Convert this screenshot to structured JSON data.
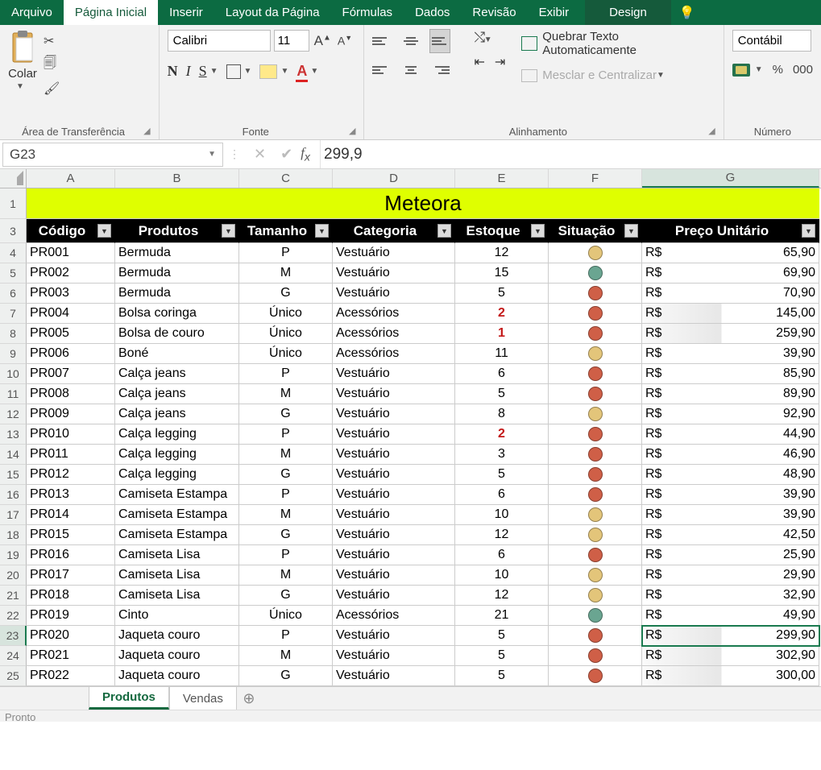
{
  "ribbon_tabs": {
    "arquivo": "Arquivo",
    "inicial": "Página Inicial",
    "inserir": "Inserir",
    "layout": "Layout da Página",
    "formulas": "Fórmulas",
    "dados": "Dados",
    "revisao": "Revisão",
    "exibir": "Exibir",
    "design": "Design"
  },
  "ribbon": {
    "colar": "Colar",
    "transferencia": "Área de Transferência",
    "font_name": "Calibri",
    "font_size": "11",
    "fonte": "Fonte",
    "quebrar": "Quebrar Texto Automaticamente",
    "mesclar": "Mesclar e Centralizar",
    "alinhamento": "Alinhamento",
    "num_fmt": "Contábil",
    "numero": "Número",
    "pct": "%",
    "zeros": "000"
  },
  "name_box": "G23",
  "formula_value": "299,9",
  "title": "Meteora",
  "columns": [
    "A",
    "B",
    "C",
    "D",
    "E",
    "F",
    "G"
  ],
  "headers": {
    "codigo": "Código",
    "produtos": "Produtos",
    "tamanho": "Tamanho",
    "categoria": "Categoria",
    "estoque": "Estoque",
    "situacao": "Situação",
    "preco": "Preço Unitário"
  },
  "cur": "R$",
  "rows": [
    {
      "n": 4,
      "cod": "PR001",
      "prod": "Bermuda",
      "tam": "P",
      "cat": "Vestuário",
      "est": "12",
      "red": false,
      "sit": "amber",
      "preco": "65,90",
      "bar": false
    },
    {
      "n": 5,
      "cod": "PR002",
      "prod": "Bermuda",
      "tam": "M",
      "cat": "Vestuário",
      "est": "15",
      "red": false,
      "sit": "green",
      "preco": "69,90",
      "bar": false
    },
    {
      "n": 6,
      "cod": "PR003",
      "prod": "Bermuda",
      "tam": "G",
      "cat": "Vestuário",
      "est": "5",
      "red": false,
      "sit": "red",
      "preco": "70,90",
      "bar": false
    },
    {
      "n": 7,
      "cod": "PR004",
      "prod": "Bolsa coringa",
      "tam": "Único",
      "cat": "Acessórios",
      "est": "2",
      "red": true,
      "sit": "red",
      "preco": "145,00",
      "bar": true
    },
    {
      "n": 8,
      "cod": "PR005",
      "prod": "Bolsa de couro",
      "tam": "Único",
      "cat": "Acessórios",
      "est": "1",
      "red": true,
      "sit": "red",
      "preco": "259,90",
      "bar": true
    },
    {
      "n": 9,
      "cod": "PR006",
      "prod": "Boné",
      "tam": "Único",
      "cat": "Acessórios",
      "est": "11",
      "red": false,
      "sit": "amber",
      "preco": "39,90",
      "bar": false
    },
    {
      "n": 10,
      "cod": "PR007",
      "prod": "Calça jeans",
      "tam": "P",
      "cat": "Vestuário",
      "est": "6",
      "red": false,
      "sit": "red",
      "preco": "85,90",
      "bar": false
    },
    {
      "n": 11,
      "cod": "PR008",
      "prod": "Calça jeans",
      "tam": "M",
      "cat": "Vestuário",
      "est": "5",
      "red": false,
      "sit": "red",
      "preco": "89,90",
      "bar": false
    },
    {
      "n": 12,
      "cod": "PR009",
      "prod": "Calça jeans",
      "tam": "G",
      "cat": "Vestuário",
      "est": "8",
      "red": false,
      "sit": "amber",
      "preco": "92,90",
      "bar": false
    },
    {
      "n": 13,
      "cod": "PR010",
      "prod": "Calça legging",
      "tam": "P",
      "cat": "Vestuário",
      "est": "2",
      "red": true,
      "sit": "red",
      "preco": "44,90",
      "bar": false
    },
    {
      "n": 14,
      "cod": "PR011",
      "prod": "Calça legging",
      "tam": "M",
      "cat": "Vestuário",
      "est": "3",
      "red": false,
      "sit": "red",
      "preco": "46,90",
      "bar": false
    },
    {
      "n": 15,
      "cod": "PR012",
      "prod": "Calça legging",
      "tam": "G",
      "cat": "Vestuário",
      "est": "5",
      "red": false,
      "sit": "red",
      "preco": "48,90",
      "bar": false
    },
    {
      "n": 16,
      "cod": "PR013",
      "prod": "Camiseta Estampa",
      "tam": "P",
      "cat": "Vestuário",
      "est": "6",
      "red": false,
      "sit": "red",
      "preco": "39,90",
      "bar": false
    },
    {
      "n": 17,
      "cod": "PR014",
      "prod": "Camiseta Estampa",
      "tam": "M",
      "cat": "Vestuário",
      "est": "10",
      "red": false,
      "sit": "amber",
      "preco": "39,90",
      "bar": false
    },
    {
      "n": 18,
      "cod": "PR015",
      "prod": "Camiseta Estampa",
      "tam": "G",
      "cat": "Vestuário",
      "est": "12",
      "red": false,
      "sit": "amber",
      "preco": "42,50",
      "bar": false
    },
    {
      "n": 19,
      "cod": "PR016",
      "prod": "Camiseta Lisa",
      "tam": "P",
      "cat": "Vestuário",
      "est": "6",
      "red": false,
      "sit": "red",
      "preco": "25,90",
      "bar": false
    },
    {
      "n": 20,
      "cod": "PR017",
      "prod": "Camiseta Lisa",
      "tam": "M",
      "cat": "Vestuário",
      "est": "10",
      "red": false,
      "sit": "amber",
      "preco": "29,90",
      "bar": false
    },
    {
      "n": 21,
      "cod": "PR018",
      "prod": "Camiseta Lisa",
      "tam": "G",
      "cat": "Vestuário",
      "est": "12",
      "red": false,
      "sit": "amber",
      "preco": "32,90",
      "bar": false
    },
    {
      "n": 22,
      "cod": "PR019",
      "prod": "Cinto",
      "tam": "Único",
      "cat": "Acessórios",
      "est": "21",
      "red": false,
      "sit": "green",
      "preco": "49,90",
      "bar": false
    },
    {
      "n": 23,
      "cod": "PR020",
      "prod": "Jaqueta couro",
      "tam": "P",
      "cat": "Vestuário",
      "est": "5",
      "red": false,
      "sit": "red",
      "preco": "299,90",
      "bar": true,
      "selected": true
    },
    {
      "n": 24,
      "cod": "PR021",
      "prod": "Jaqueta couro",
      "tam": "M",
      "cat": "Vestuário",
      "est": "5",
      "red": false,
      "sit": "red",
      "preco": "302,90",
      "bar": true
    },
    {
      "n": 25,
      "cod": "PR022",
      "prod": "Jaqueta couro",
      "tam": "G",
      "cat": "Vestuário",
      "est": "5",
      "red": false,
      "sit": "red",
      "preco": "300,00",
      "bar": true
    }
  ],
  "sheets": {
    "produtos": "Produtos",
    "vendas": "Vendas"
  },
  "status": "Pronto"
}
